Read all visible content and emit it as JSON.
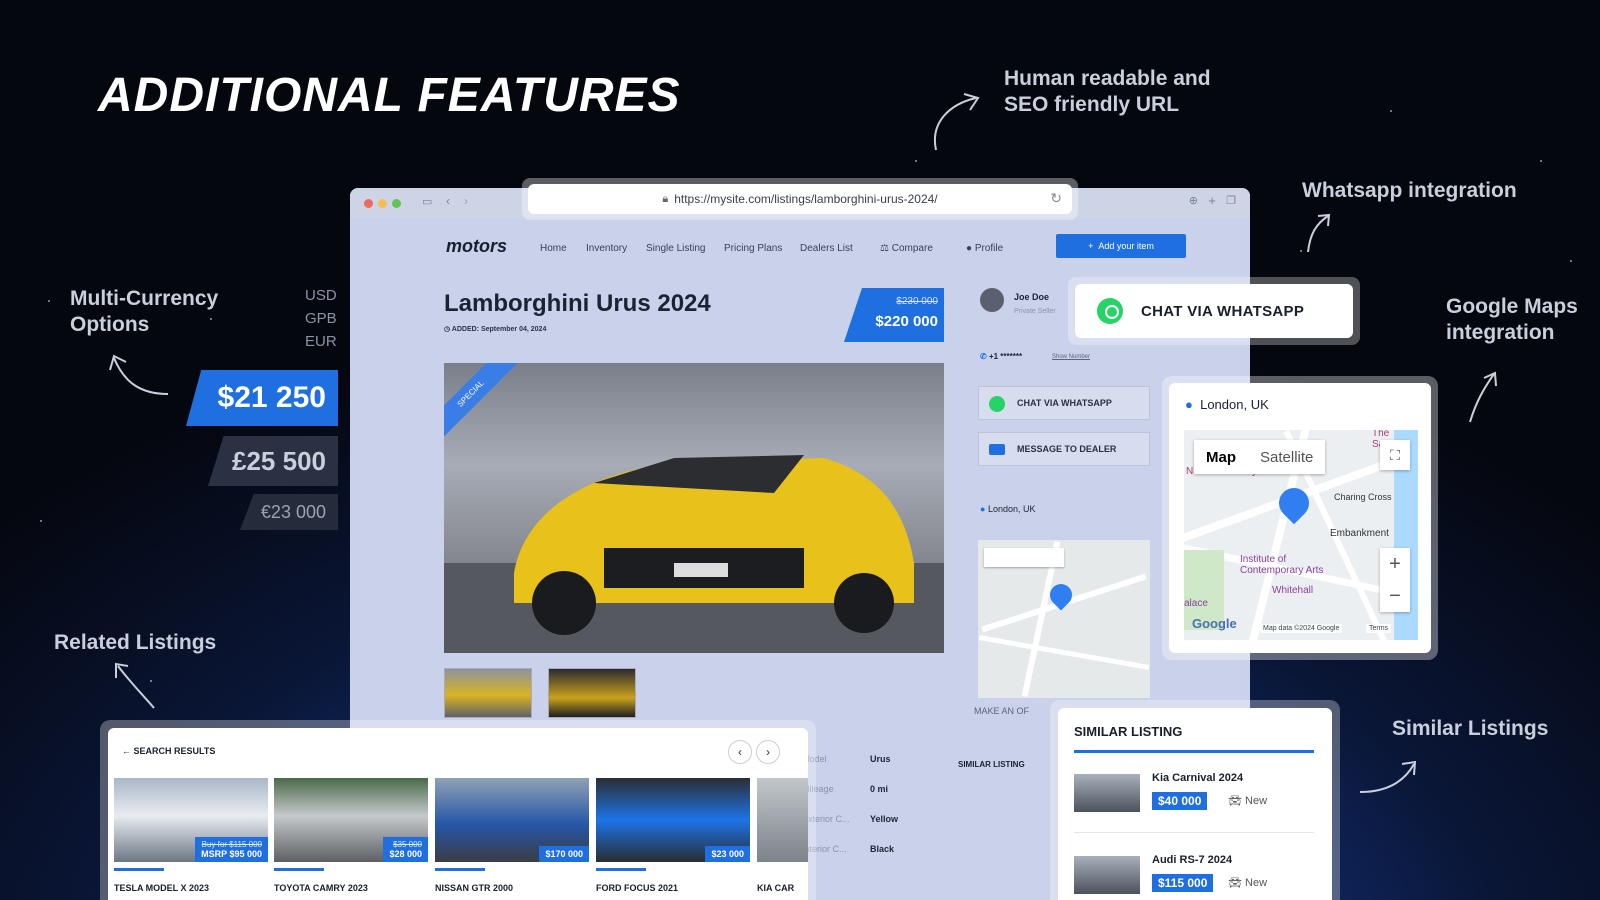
{
  "headline": "ADDITIONAL FEATURES",
  "features": {
    "seo_url": "Human readable and\nSEO friendly URL",
    "whatsapp": "Whatsapp integration",
    "google_maps": "Google Maps\nintegration",
    "multi_currency": "Multi-Currency\nOptions",
    "related": "Related Listings",
    "similar": "Similar Listings"
  },
  "browser": {
    "url": "https://mysite.com/listings/lamborghini-urus-2024/",
    "logo": "motors",
    "nav": [
      "Home",
      "Inventory",
      "Single Listing",
      "Pricing Plans",
      "Dealers List",
      "Compare",
      "Profile"
    ],
    "add_item": "Add your item",
    "listing_title": "Lamborghini Urus 2024",
    "added": "ADDED: September 04, 2024",
    "special_badge": "SPECIAL",
    "old_price": "$230 000",
    "price": "$220 000",
    "seller_name": "Joe Doe",
    "seller_role": "Private Seller",
    "phone": "+1 *******",
    "show_number": "Show Number",
    "chat_whatsapp": "CHAT VIA WHATSAPP",
    "message_dealer": "MESSAGE TO DEALER",
    "location": "London, UK",
    "map_tab": "Map",
    "satellite_tab": "Satellite",
    "make_offer": "MAKE AN OF",
    "similar_short": "SIMILAR LISTING",
    "specs": [
      {
        "label": "Model",
        "value": "Urus"
      },
      {
        "label": "Mileage",
        "value": "0 mi"
      },
      {
        "label": "Exterior C...",
        "value": "Yellow"
      },
      {
        "label": "Interior C...",
        "value": "Black"
      }
    ]
  },
  "currency": {
    "codes": [
      "USD",
      "GPB",
      "EUR"
    ],
    "prices": [
      "$21 250",
      "£25 500",
      "€23 000"
    ]
  },
  "whatsapp_card": {
    "label": "CHAT VIA WHATSAPP"
  },
  "map_card": {
    "location": "London, UK",
    "tab_map": "Map",
    "tab_satellite": "Satellite",
    "labels": [
      "The Savoy",
      "National Gallery",
      "Charing Cross",
      "Embankment",
      "Institute of\nContemporary Arts",
      "Whitehall",
      "alace"
    ],
    "google": "Google",
    "footer": "Map data ©2024 Google",
    "terms": "Terms"
  },
  "search_results": {
    "title": "← SEARCH RESULTS",
    "items": [
      {
        "name": "TESLA MODEL X 2023",
        "strike": "Buy for $115 000",
        "price": "MSRP $95 000"
      },
      {
        "name": "TOYOTA CAMRY 2023",
        "strike": "$35 000",
        "price": "$28 000"
      },
      {
        "name": "NISSAN GTR 2000",
        "strike": "",
        "price": "$170 000"
      },
      {
        "name": "FORD FOCUS 2021",
        "strike": "",
        "price": "$23 000"
      },
      {
        "name": "KIA CAR",
        "strike": "",
        "price": ""
      }
    ]
  },
  "similar_card": {
    "title": "SIMILAR LISTING",
    "items": [
      {
        "name": "Kia Carnival 2024",
        "price": "$40 000",
        "condition": "New"
      },
      {
        "name": "Audi RS-7 2024",
        "price": "$115 000",
        "condition": "New"
      }
    ]
  },
  "colors": {
    "accent": "#1f6fe0",
    "whatsapp": "#25d366"
  }
}
